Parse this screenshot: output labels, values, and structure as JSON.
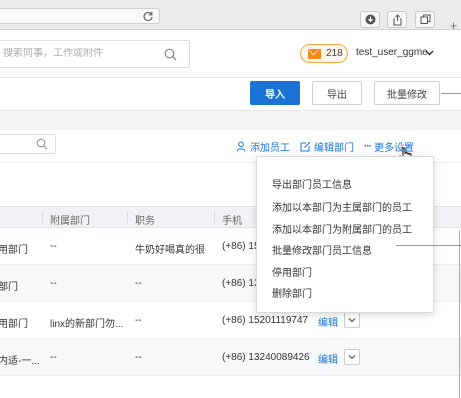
{
  "header": {
    "search_placeholder": "搜索同事，工作或附件",
    "mail_count": "218",
    "username": "test_user_ggme"
  },
  "toolbar": {
    "import_label": "导入",
    "export_label": "导出",
    "batch_edit_label": "批量修改"
  },
  "filter": {
    "add_employee": "添加员工",
    "edit_department": "编辑部门",
    "more_settings": "更多设置"
  },
  "table": {
    "columns": [
      "附属部门",
      "职务",
      "手机"
    ],
    "rows": [
      {
        "dept": "用部门",
        "sub_dept": "--",
        "title": "牛奶好喝真的很",
        "phone": "(+86) 152",
        "edit": ""
      },
      {
        "dept": "部门",
        "sub_dept": "--",
        "title": "--",
        "phone": "(+86) 13",
        "edit": ""
      },
      {
        "dept": "用部门",
        "sub_dept": "linx的新部门勿...",
        "title": "--",
        "phone": "(+86) 15201119747",
        "edit": "编辑"
      },
      {
        "dept": "内适-一...",
        "sub_dept": "--",
        "title": "--",
        "phone": "(+86) 13240089426",
        "edit": "编辑"
      },
      {
        "dept": "",
        "sub_dept": "",
        "title": "",
        "phone": "",
        "edit": ""
      }
    ]
  },
  "menu": {
    "items": [
      "导出部门员工信息",
      "添加以本部门为主属部门的员工",
      "添加以本部门为附属部门的员工",
      "批量修改部门员工信息",
      "停用部门",
      "删除部门"
    ]
  },
  "colors": {
    "primary": "#1a74d6",
    "mail_badge": "#f08a1c"
  }
}
